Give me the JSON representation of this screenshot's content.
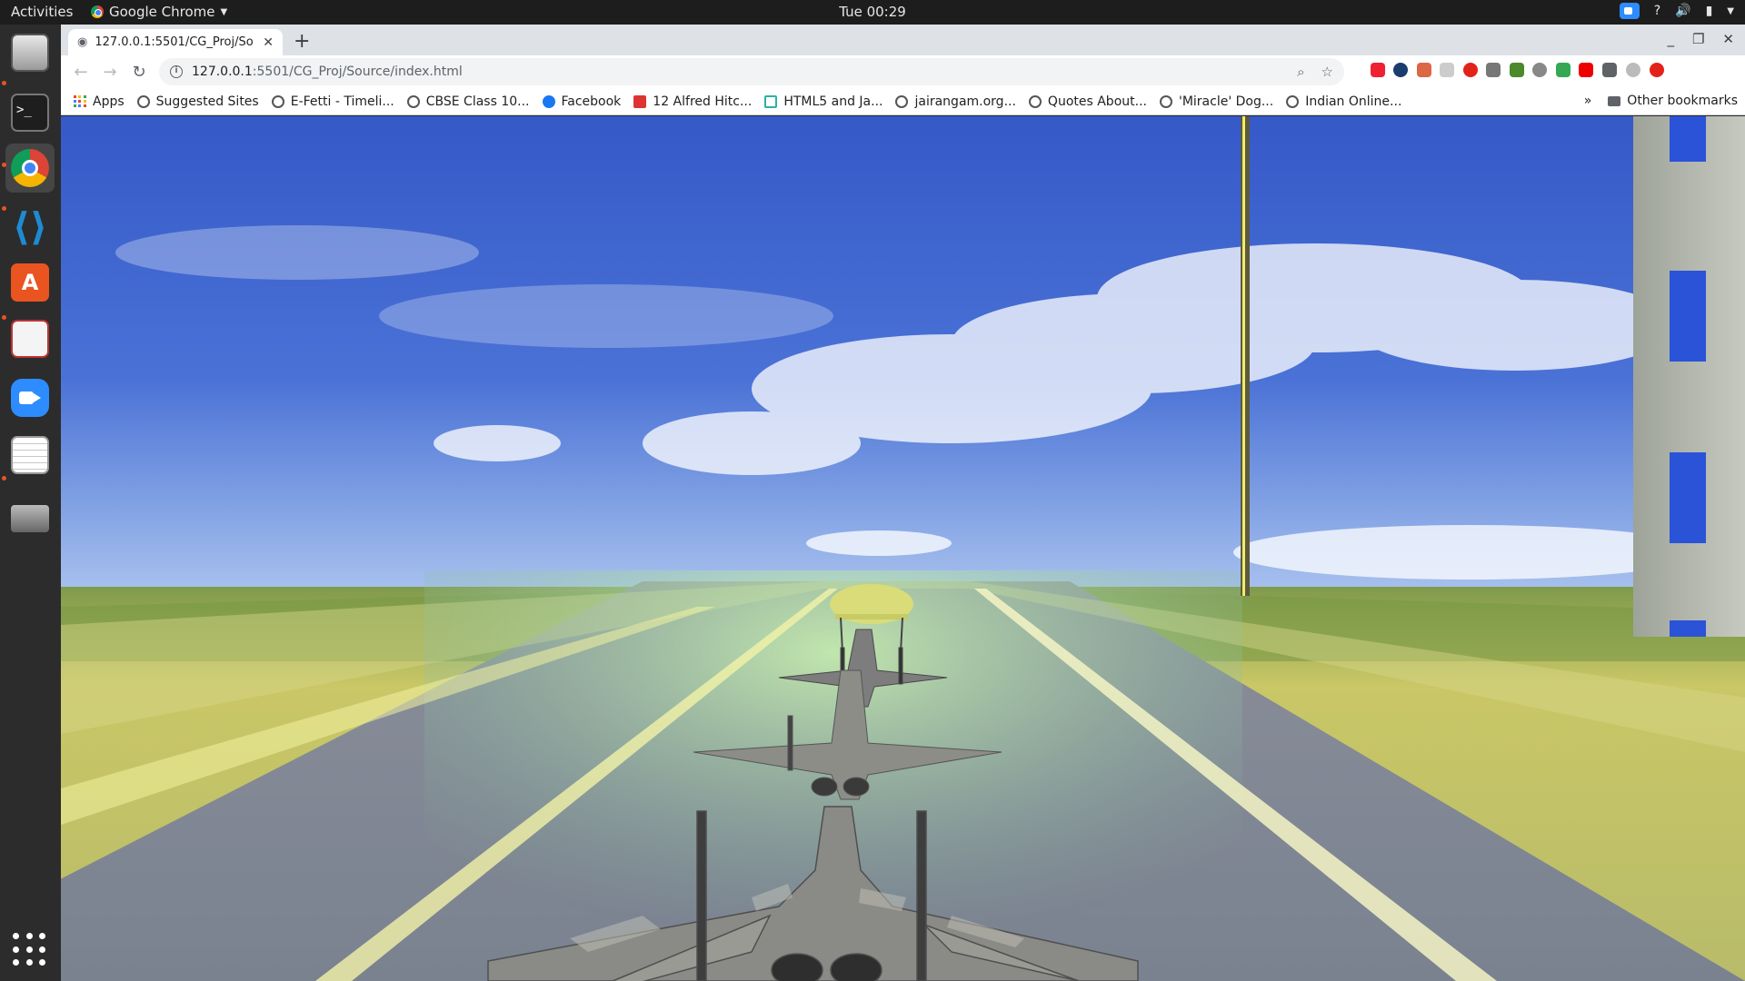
{
  "topbar": {
    "activities": "Activities",
    "app_name": "Google Chrome",
    "clock": "Tue 00:29",
    "tray_help": "?"
  },
  "dock": {
    "items": [
      "files",
      "terminal",
      "chrome",
      "vscode",
      "software-center",
      "document-viewer",
      "zoom",
      "text-editor",
      "scanner"
    ]
  },
  "browser": {
    "tab_title": "127.0.0.1:5501/CG_Proj/So",
    "url_host": "127.0.0.1",
    "url_path": ":5501/CG_Proj/Source/index.html",
    "bookmarks": [
      "Apps",
      "Suggested Sites",
      "E-Fetti - Timeli...",
      "CBSE Class 10...",
      "Facebook",
      "12 Alfred Hitc...",
      "HTML5 and Ja...",
      "jairangam.org...",
      "Quotes About...",
      "'Miracle' Dog...",
      "Indian Online..."
    ],
    "overflow": "»",
    "other_bookmarks": "Other bookmarks"
  },
  "colors": {
    "sky_top": "#3a5fd0",
    "sky_horizon": "#9ab8ee",
    "runway": "#7d8694",
    "grass": "#8aa64a",
    "jet": "#8c8c8c"
  }
}
